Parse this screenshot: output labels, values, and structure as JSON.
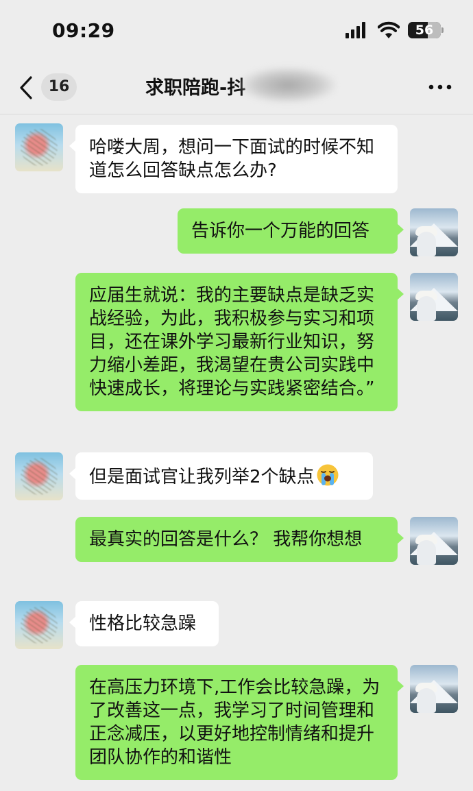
{
  "status_bar": {
    "time": "09:29",
    "battery_level": "56"
  },
  "nav": {
    "unread_count": "16",
    "title": "求职陪跑-抖"
  },
  "messages": [
    {
      "side": "in",
      "text": "哈喽大周，想问一下面试的时候不知道怎么回答缺点怎么办?"
    },
    {
      "side": "out",
      "text": "告诉你一个万能的回答"
    },
    {
      "side": "out",
      "text": "应届生就说：我的主要缺点是缺乏实战经验，为此，我积极参与实习和项目，还在课外学习最新行业知识，努力缩小差距，我渴望在贵公司实践中快速成长，将理论与实践紧密结合。”"
    },
    {
      "side": "in",
      "text": "但是面试官让我列举2个缺点",
      "emoji": "loudly-crying-face-icon"
    },
    {
      "side": "out",
      "text": "最真实的回答是什么？ 我帮你想想"
    },
    {
      "side": "in",
      "text": "性格比较急躁"
    },
    {
      "side": "out",
      "text": "在高压力环境下,工作会比较急躁，为了改善这一点，我学习了时间管理和正念减压，以更好地控制情绪和提升团队协作的和谐性"
    }
  ],
  "colors": {
    "background": "#ededed",
    "incoming_bubble": "#ffffff",
    "outgoing_bubble": "#95ec69"
  }
}
